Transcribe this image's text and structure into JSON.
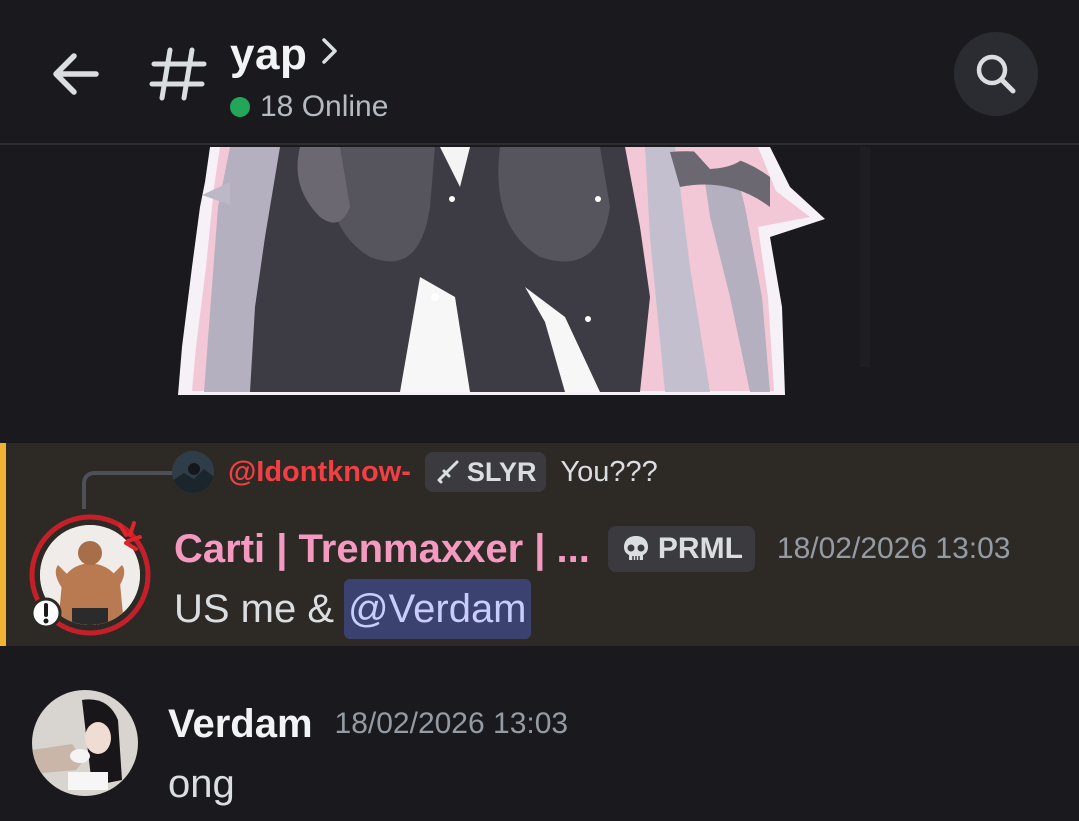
{
  "header": {
    "channel_name": "yap",
    "online_text": "18 Online"
  },
  "reply": {
    "username": "@Idontknow-",
    "tag": "SLYR",
    "text": "You???"
  },
  "highlighted_message": {
    "author": "Carti | Trenmaxxer | ...",
    "tag": "PRML",
    "timestamp": "18/02/2026 13:03",
    "text": "US me &",
    "mention": "@Verdam"
  },
  "next_message": {
    "author": "Verdam",
    "timestamp": "18/02/2026 13:03",
    "text": "ong"
  },
  "colors": {
    "background": "#1a1a1e",
    "highlight_bg": "#2d2a26",
    "highlight_bar": "#f0b232",
    "reply_name": "#f23f43",
    "author_pink": "#f49ac1",
    "mention_bg": "#3c4270",
    "online": "#23a55a"
  },
  "icons": {
    "back": "arrow-left-icon",
    "channel": "hash-icon",
    "title_chevron": "chevron-right-icon",
    "search": "search-icon",
    "slyr_tag": "sword-icon",
    "prml_tag": "skull-icon",
    "status": "alert-icon",
    "anger": "anger-icon"
  }
}
